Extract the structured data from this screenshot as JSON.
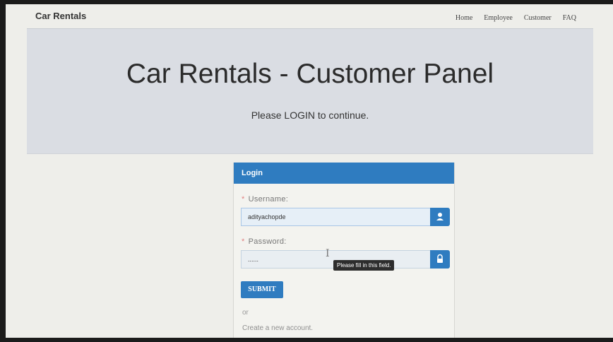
{
  "navbar": {
    "brand": "Car Rentals",
    "links": [
      "Home",
      "Employee",
      "Customer",
      "FAQ"
    ]
  },
  "hero": {
    "title": "Car Rentals - Customer Panel",
    "subtitle": "Please LOGIN to continue."
  },
  "login": {
    "heading": "Login",
    "username": {
      "required_mark": "*",
      "label": "Username:",
      "value": "adityachopde",
      "icon": "user-icon"
    },
    "password": {
      "required_mark": "*",
      "label": "Password:",
      "value": "......",
      "icon": "lock-icon"
    },
    "tooltip": "Please fill in this field.",
    "submit_label": "SUBMIT",
    "or_text": "or",
    "create_account_label": "Create a new account."
  },
  "colors": {
    "accent": "#2f7cc0",
    "hero_bg": "#dadde3",
    "page_bg": "#eeeeea"
  }
}
